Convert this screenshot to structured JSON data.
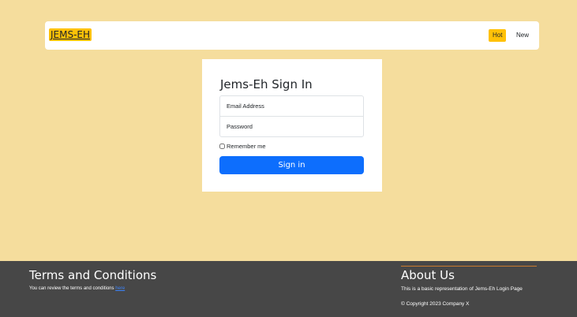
{
  "nav": {
    "brand": "JEMS-EH",
    "hot": "Hot",
    "new": "New"
  },
  "login": {
    "title": "Jems-Eh Sign In",
    "email_placeholder": "Email Address",
    "password_placeholder": "Password",
    "remember": "Remember me",
    "signin": "Sign in"
  },
  "footer": {
    "terms_title": "Terms and Conditions",
    "terms_text": "You can review the terms and conditions ",
    "terms_link": "here",
    "about_title": "About Us",
    "about_text": "This is a basic representation of Jems-Eh Login Page",
    "copyright": "© Copyright 2023 Company X"
  },
  "colors": {
    "background": "#f5dd9d",
    "accent": "#ffc107",
    "primary": "#0d6efd",
    "footer": "#474747"
  }
}
